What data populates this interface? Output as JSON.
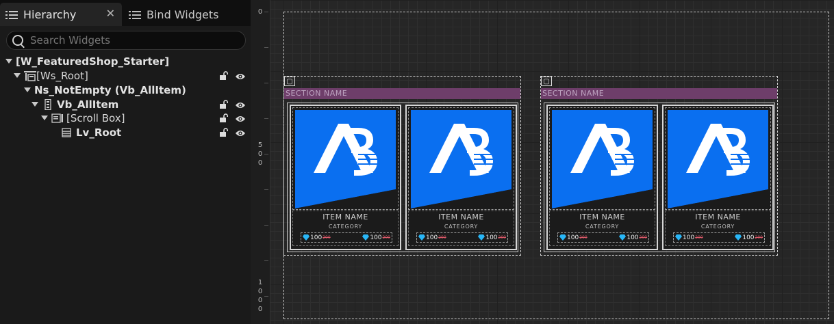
{
  "tabs": [
    {
      "label": "Hierarchy",
      "icon": "list-icon",
      "active": true
    },
    {
      "label": "Bind Widgets",
      "icon": "list-icon",
      "active": false
    }
  ],
  "search": {
    "placeholder": "Search Widgets",
    "value": ""
  },
  "tree": [
    {
      "label": "[W_FeaturedShop_Starter]",
      "depth": 0,
      "bold": true,
      "expanded": true,
      "icon": null
    },
    {
      "label": "[Ws_Root]",
      "depth": 1,
      "bold": false,
      "expanded": true,
      "icon": "widget-switcher-icon"
    },
    {
      "label": "Ns_NotEmpty (Vb_AllItem)",
      "depth": 2,
      "bold": true,
      "expanded": true,
      "icon": null
    },
    {
      "label": "Vb_AllItem",
      "depth": 3,
      "bold": true,
      "expanded": true,
      "icon": "vertical-box-icon"
    },
    {
      "label": "[Scroll Box]",
      "depth": 4,
      "bold": false,
      "expanded": true,
      "icon": "scroll-box-icon"
    },
    {
      "label": "Lv_Root",
      "depth": 5,
      "bold": true,
      "expanded": false,
      "icon": "list-view-icon"
    }
  ],
  "ruler": {
    "marks": [
      "0",
      "5\n0\n0",
      "1\n0\n0\n0"
    ]
  },
  "sections": [
    {
      "title": "SECTION NAME",
      "cards": [
        {
          "name": "ITEM NAME",
          "category": "CATEGORY",
          "prices": [
            {
              "value": "100",
              "old": "200"
            },
            {
              "value": "100",
              "old": "200"
            }
          ]
        },
        {
          "name": "ITEM NAME",
          "category": "CATEGORY",
          "prices": [
            {
              "value": "100",
              "old": "200"
            },
            {
              "value": "100",
              "old": "200"
            }
          ]
        }
      ]
    },
    {
      "title": "SECTION NAME",
      "cards": [
        {
          "name": "ITEM NAME",
          "category": "CATEGORY",
          "prices": [
            {
              "value": "100",
              "old": "200"
            },
            {
              "value": "100",
              "old": "200"
            }
          ]
        },
        {
          "name": "ITEM NAME",
          "category": "CATEGORY",
          "prices": [
            {
              "value": "100",
              "old": "200"
            },
            {
              "value": "100",
              "old": "200"
            }
          ]
        }
      ]
    }
  ],
  "colors": {
    "accent_blue": "#0a6ff0",
    "section_bar": "#6e3e6a",
    "price_strike": "#e05a6a",
    "gem": "#29b6f6"
  }
}
